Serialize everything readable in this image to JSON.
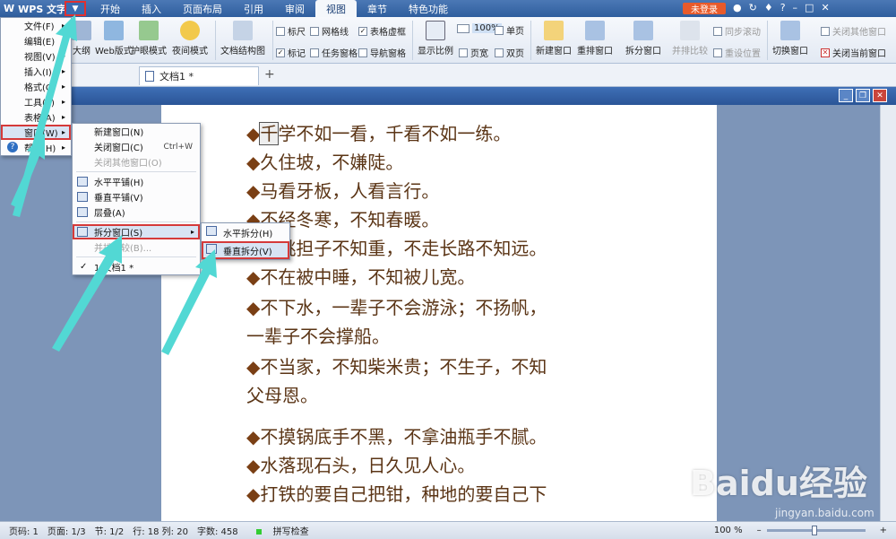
{
  "app": {
    "title": "WPS 文字",
    "login": "未登录"
  },
  "tabs": [
    "开始",
    "插入",
    "页面布局",
    "引用",
    "审阅",
    "视图",
    "章节",
    "特色功能"
  ],
  "ribbon": {
    "outline": "大纲",
    "web": "Web版式",
    "eye": "护眼模式",
    "night": "夜间模式",
    "docmap": "文档结构图",
    "ruler": "标尺",
    "grid": "网格线",
    "tablegrid": "表格虚框",
    "marks": "标记",
    "taskpane": "任务窗格",
    "navpane": "导航窗格",
    "zoom": "显示比例",
    "pct": "100%",
    "pagewidth": "页宽",
    "single": "单页",
    "double": "双页",
    "newwin": "新建窗口",
    "arrange": "重排窗口",
    "split": "拆分窗口",
    "compare": "并排比较",
    "sync": "同步滚动",
    "resetpos": "重设位置",
    "switch": "切换窗口",
    "closeother": "关闭其他窗口",
    "closecur": "关闭当前窗口"
  },
  "doctab": "文档1 *",
  "menu1": [
    {
      "label": "文件(F)"
    },
    {
      "label": "编辑(E)"
    },
    {
      "label": "视图(V)"
    },
    {
      "label": "插入(I)"
    },
    {
      "label": "格式(O)"
    },
    {
      "label": "工具(T)"
    },
    {
      "label": "表格(A)"
    },
    {
      "label": "窗口(W)"
    },
    {
      "label": "帮助(H)"
    }
  ],
  "menu2": {
    "newwin": "新建窗口(N)",
    "closewin": "关闭窗口(C)",
    "closewin_sc": "Ctrl+W",
    "closeother": "关闭其他窗口(O)",
    "htile": "水平平铺(H)",
    "vtile": "垂直平铺(V)",
    "cascade": "层叠(A)",
    "split": "拆分窗口(S)",
    "compare": "并排比较(B)...",
    "doc1": "1 文档1 *"
  },
  "menu3": {
    "hsplit": "水平拆分(H)",
    "vsplit": "垂直拆分(V)"
  },
  "doc": {
    "l1": "学不如一看，千看不如一练。",
    "l1c": "千",
    "l2": "久住坡，不嫌陡。",
    "l3": "马看牙板，人看言行。",
    "l4": "不经冬寒，不知春暖。",
    "l5": "不挑担子不知重，不走长路不知远。",
    "l6": "不在被中睡，不知被儿宽。",
    "l7": "不下水，一辈子不会游泳；不扬帆，",
    "l7b": "一辈子不会撑船。",
    "l8": "不当家，不知柴米贵；不生子，不知",
    "l8b": "父母恩。",
    "l9": "不摸锅底手不黑，不拿油瓶手不腻。",
    "l10": "水落现石头，日久见人心。",
    "l11": "打铁的要自己把钳，种地的要自己下"
  },
  "status": {
    "page": "页码: 1",
    "pages": "页面: 1/3",
    "section": "节: 1/2",
    "rowcol": "行: 18 列: 20",
    "words": "字数: 458",
    "spell": "拼写检查",
    "zoom": "100 %"
  },
  "watermark": {
    "main": "Baidu经验",
    "sub": "jingyan.baidu.com"
  },
  "colors": {
    "accent": "#2f5e9e",
    "highlight": "#d53a3a",
    "arrow": "#4fd6d6",
    "text": "#5b3516"
  }
}
